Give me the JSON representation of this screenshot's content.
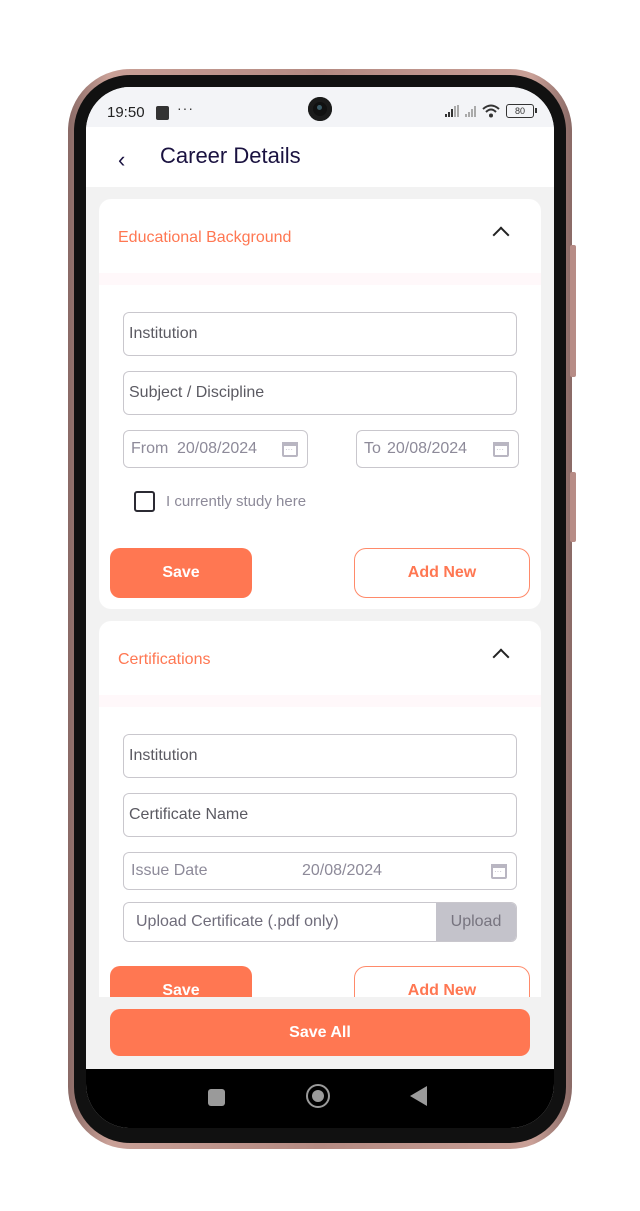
{
  "status_bar": {
    "time": "19:50",
    "dots": "···",
    "battery": "80"
  },
  "app_bar": {
    "back_icon": "‹",
    "title": "Career Details"
  },
  "education": {
    "title": "Educational Background",
    "institution_placeholder": "Institution",
    "subject_placeholder": "Subject / Discipline",
    "from_label": "From",
    "from_date": "20/08/2024",
    "to_label": "To",
    "to_date": "20/08/2024",
    "checkbox_label": "I currently study here",
    "checkbox_checked": false,
    "save_label": "Save",
    "add_new_label": "Add New"
  },
  "certifications": {
    "title": "Certifications",
    "institution_placeholder": "Institution",
    "certificate_name_placeholder": "Certificate Name",
    "issue_date_label": "Issue Date",
    "issue_date": "20/08/2024",
    "upload_placeholder": "Upload Certificate (.pdf only)",
    "upload_button": "Upload",
    "save_label": "Save",
    "add_new_label": "Add New"
  },
  "footer": {
    "save_all_label": "Save All"
  },
  "colors": {
    "accent": "#ff7752",
    "title": "#1a1240",
    "background": "#f2f2f2"
  }
}
